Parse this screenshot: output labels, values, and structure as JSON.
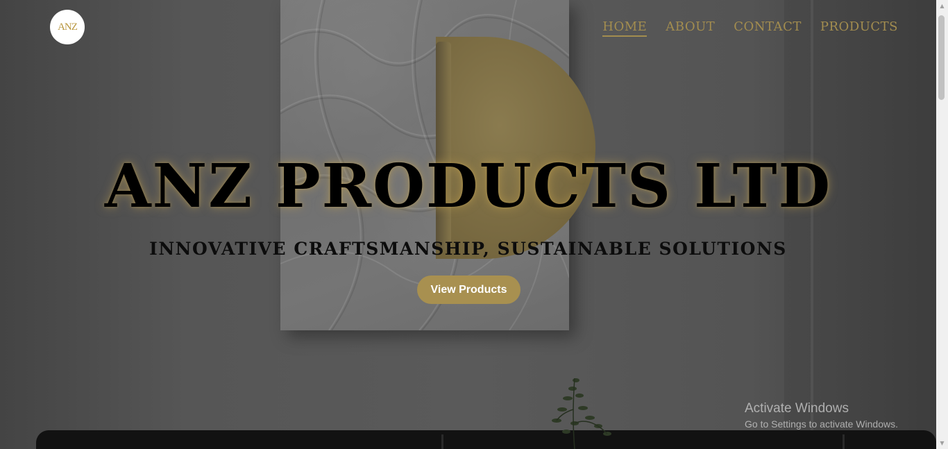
{
  "header": {
    "logo_text": "ANZ"
  },
  "nav": {
    "items": [
      {
        "label": "HOME",
        "active": true
      },
      {
        "label": "ABOUT",
        "active": false
      },
      {
        "label": "CONTACT",
        "active": false
      },
      {
        "label": "PRODUCTS",
        "active": false
      }
    ]
  },
  "hero": {
    "title": "ANZ PRODUCTS LTD",
    "subtitle": "INNOVATIVE CRAFTSMANSHIP, SUSTAINABLE SOLUTIONS",
    "cta_label": "View Products"
  },
  "watermark": {
    "title": "Activate Windows",
    "subtitle": "Go to Settings to activate Windows."
  },
  "scrollbar": {
    "up_icon": "▲",
    "down_icon": "▼"
  },
  "colors": {
    "accent_gold": "#a89050",
    "nav_text": "#a38d4f",
    "title_text": "#000000",
    "overlay": "#4f4f4f"
  }
}
